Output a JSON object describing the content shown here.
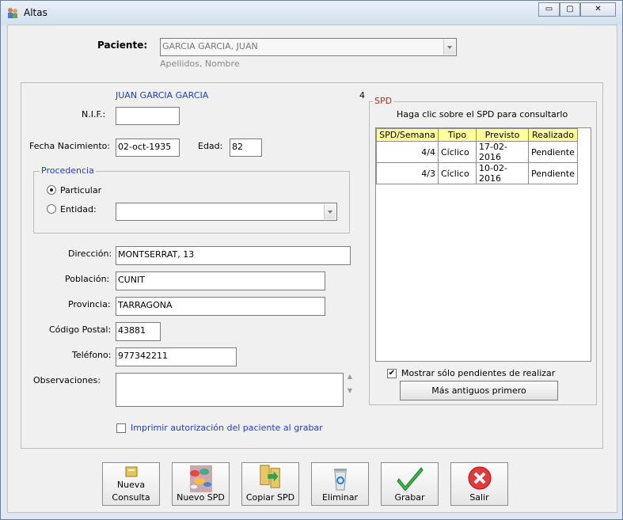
{
  "window": {
    "title": "Altas",
    "controls": {
      "minimize": "▭",
      "maximize": "▢",
      "close": "✕"
    }
  },
  "patient": {
    "label": "Paciente:",
    "value": "GARCIA GARCIA, JUAN",
    "hint": "Apellidos, Nombre"
  },
  "detail": {
    "name": "JUAN GARCIA GARCIA",
    "count": "4",
    "nif_label": "N.I.F.:",
    "nif_value": "",
    "birth_label": "Fecha Nacimiento:",
    "birth_value": "02-oct-1935",
    "age_label": "Edad:",
    "age_value": "82"
  },
  "procedencia": {
    "title": "Procedencia",
    "particular_label": "Particular",
    "entidad_label": "Entidad:",
    "entidad_value": "",
    "selected": "Particular"
  },
  "address": {
    "direccion_label": "Dirección:",
    "direccion_value": "MONTSERRAT, 13",
    "poblacion_label": "Población:",
    "poblacion_value": "CUNIT",
    "provincia_label": "Provincia:",
    "provincia_value": "TARRAGONA",
    "cp_label": "Código Postal:",
    "cp_value": "43881",
    "telefono_label": "Teléfono:",
    "telefono_value": "977342211",
    "obs_label": "Observaciones:",
    "obs_value": ""
  },
  "print_auth": {
    "label": "Imprimir autorización del paciente al grabar",
    "checked": false
  },
  "spd": {
    "title": "SPD",
    "hint": "Haga clic sobre el SPD para consultarlo",
    "columns": [
      "SPD/Semana",
      "Tipo",
      "Previsto",
      "Realizado"
    ],
    "rows": [
      [
        "4/4",
        "Cíclico",
        "17-02-2016",
        "Pendiente"
      ],
      [
        "4/3",
        "Cíclico",
        "10-02-2016",
        "Pendiente"
      ]
    ],
    "only_pending_label": "Mostrar sólo pendientes de realizar",
    "only_pending_checked": true,
    "older_first_label": "Más antiguos primero"
  },
  "toolbar": {
    "nueva_consulta_1": "Nueva",
    "nueva_consulta_2": "Consulta",
    "nuevo_spd": "Nuevo SPD",
    "copiar_spd": "Copiar SPD",
    "eliminar": "Eliminar",
    "grabar": "Grabar",
    "salir": "Salir"
  },
  "colors": {
    "link_blue": "#1f3fbf",
    "spd_red": "#cc2222",
    "header_yellow": "#ffff99"
  }
}
